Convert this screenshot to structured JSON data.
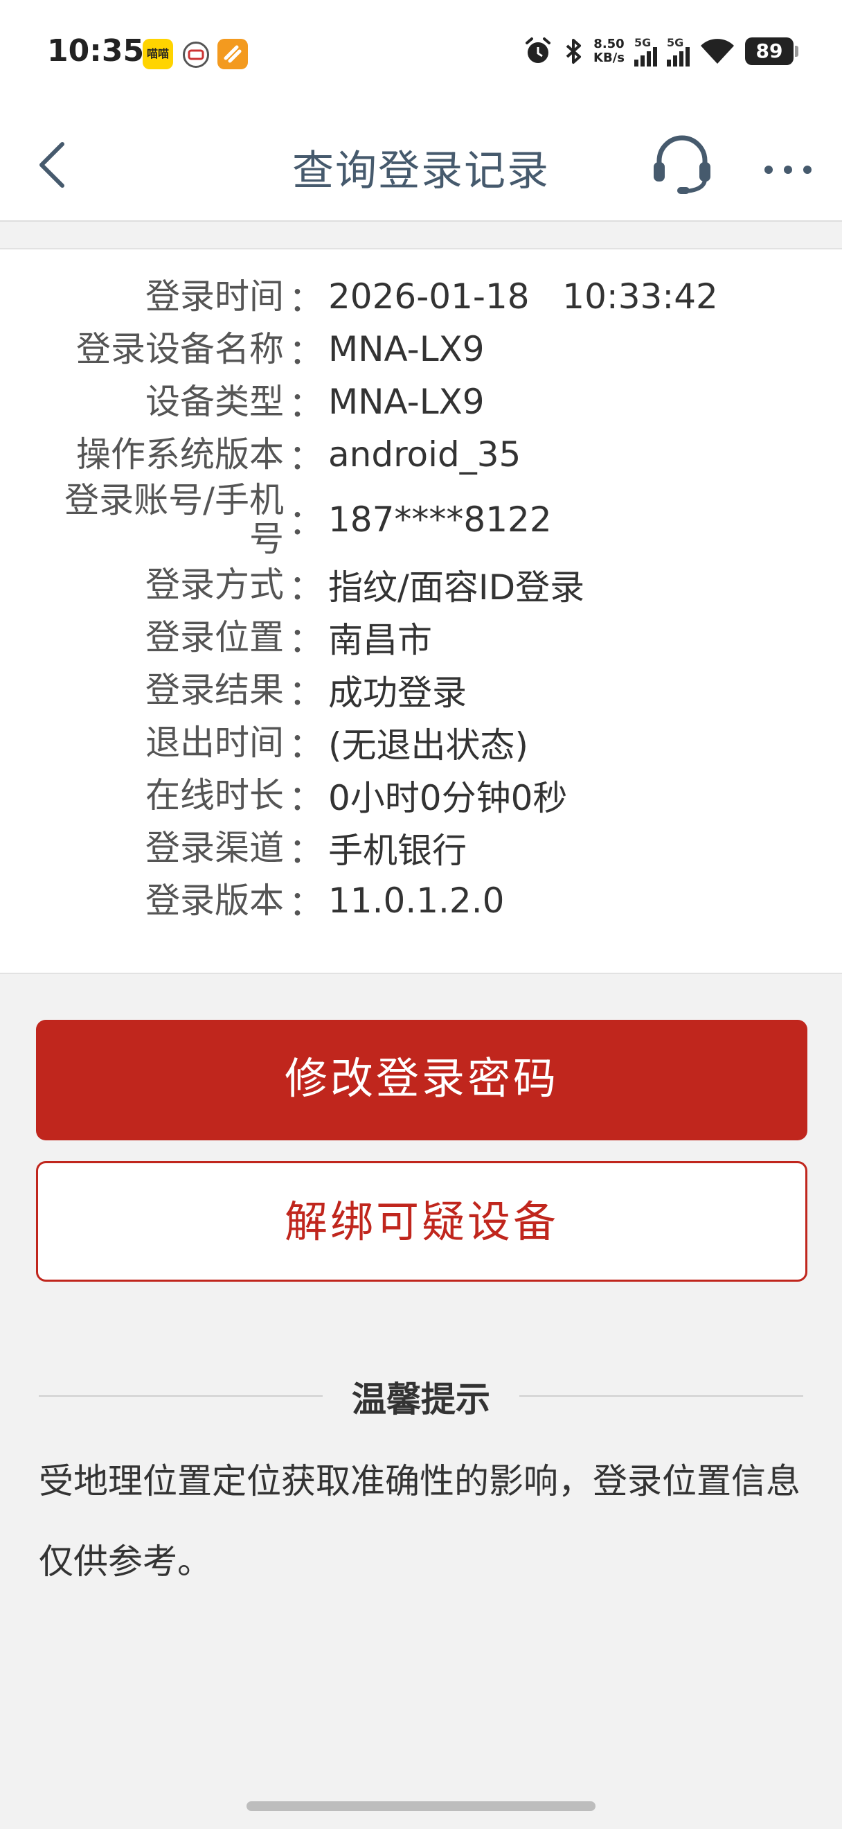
{
  "status_bar": {
    "time": "10:35",
    "app_icon_1": "喵喵",
    "net_speed_value": "8.50",
    "net_speed_unit": "KB/s",
    "signal_1_label": "5G",
    "signal_2_label": "5G",
    "battery": "89"
  },
  "nav": {
    "title": "查询登录记录",
    "back_icon": "chevron-left-icon",
    "service_icon": "headset-icon",
    "more_icon": "more-dots-icon"
  },
  "records": [
    {
      "label": "登录时间",
      "value": "2026-01-18   10:33:42"
    },
    {
      "label": "登录设备名称",
      "value": "MNA-LX9"
    },
    {
      "label": "设备类型",
      "value": "MNA-LX9"
    },
    {
      "label": "操作系统版本",
      "value": "android_35"
    },
    {
      "label": "登录账号/手机号",
      "label_line1": "登录账号/手机",
      "label_line2": "号",
      "value": "187****8122"
    },
    {
      "label": "登录方式",
      "value": "指纹/面容ID登录"
    },
    {
      "label": "登录位置",
      "value": "南昌市"
    },
    {
      "label": "登录结果",
      "value": "成功登录"
    },
    {
      "label": "退出时间",
      "value": "(无退出状态)"
    },
    {
      "label": "在线时长",
      "value": "0小时0分钟0秒"
    },
    {
      "label": "登录渠道",
      "value": "手机银行"
    },
    {
      "label": "登录版本",
      "value": "11.0.1.2.0"
    }
  ],
  "colon": "：",
  "actions": {
    "change_password": "修改登录密码",
    "unbind_device": "解绑可疑设备"
  },
  "tips": {
    "title": "温馨提示",
    "text": "受地理位置定位获取准确性的影响，登录位置信息仅供参考。"
  },
  "colors": {
    "primary_red": "#c0261d",
    "title_text": "#465a6d",
    "background": "#f2f2f2"
  }
}
